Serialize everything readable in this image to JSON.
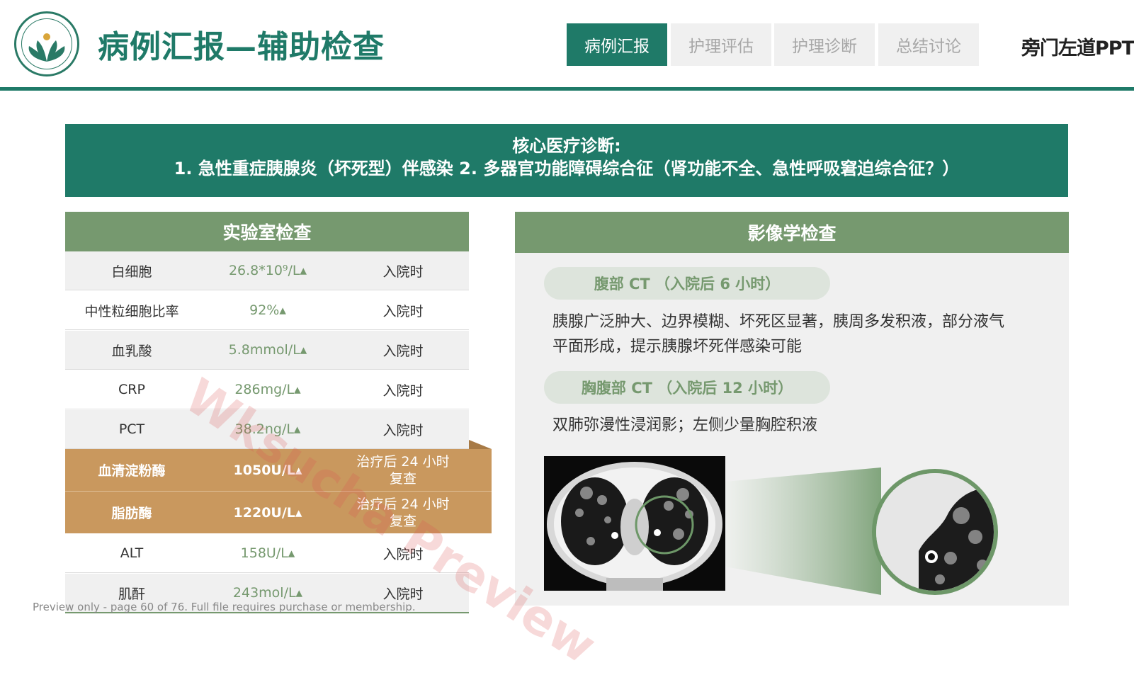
{
  "header": {
    "title": "病例汇报—辅助检查",
    "tabs": [
      {
        "label": "病例汇报",
        "active": true
      },
      {
        "label": "护理评估",
        "active": false
      },
      {
        "label": "护理诊断",
        "active": false
      },
      {
        "label": "总结讨论",
        "active": false
      }
    ],
    "brand": "旁门左道PPT"
  },
  "banner": {
    "line1": "核心医疗诊断:",
    "line2": "1. 急性重症胰腺炎（坏死型）伴感染  2. 多器官功能障碍综合征（肾功能不全、急性呼吸窘迫综合征？）"
  },
  "lab": {
    "title": "实验室检查",
    "rows": [
      {
        "name": "白细胞",
        "value": "26.8*10⁹/L▴",
        "time": "入院时",
        "highlight": false
      },
      {
        "name": "中性粒细胞比率",
        "value": "92%▴",
        "time": "入院时",
        "highlight": false
      },
      {
        "name": "血乳酸",
        "value": "5.8mmol/L▴",
        "time": "入院时",
        "highlight": false
      },
      {
        "name": "CRP",
        "value": "286mg/L▴",
        "time": "入院时",
        "highlight": false
      },
      {
        "name": "PCT",
        "value": "38.2ng/L▴",
        "time": "入院时",
        "highlight": false
      },
      {
        "name": "血清淀粉酶",
        "value": "1050U/L▴",
        "time": "治疗后 24 小时复查",
        "time_l1": "治疗后 24 小时",
        "time_l2": "复查",
        "highlight": true
      },
      {
        "name": "脂肪酶",
        "value": "1220U/L▴",
        "time": "治疗后 24 小时复查",
        "time_l1": "治疗后 24 小时",
        "time_l2": "复查",
        "highlight": true
      },
      {
        "name": "ALT",
        "value": "158U/L▴",
        "time": "入院时",
        "highlight": false
      },
      {
        "name": "肌酐",
        "value": "243mol/L▴",
        "time": "入院时",
        "highlight": false
      }
    ]
  },
  "imaging": {
    "title": "影像学检查",
    "sections": [
      {
        "label": "腹部 CT （入院后 6 小时）",
        "text_l1": "胰腺广泛肿大、边界模糊、坏死区显著，胰周多发积液，部分液气",
        "text_l2": "平面形成，提示胰腺坏死伴感染可能"
      },
      {
        "label": "胸腹部 CT （入院后 12 小时）",
        "text_l1": "双肺弥漫性浸润影；左侧少量胸腔积液",
        "text_l2": ""
      }
    ]
  },
  "overlay": {
    "watermark": "Wksucha Preview",
    "note": "Preview only - page 60 of 76. Full file requires purchase or membership."
  },
  "colors": {
    "primary": "#1f7a68",
    "section": "#76996f",
    "highlight": "#c9985e",
    "tab_idle": "#f0f0f0",
    "tab_idle_text": "#a7a7a7"
  }
}
